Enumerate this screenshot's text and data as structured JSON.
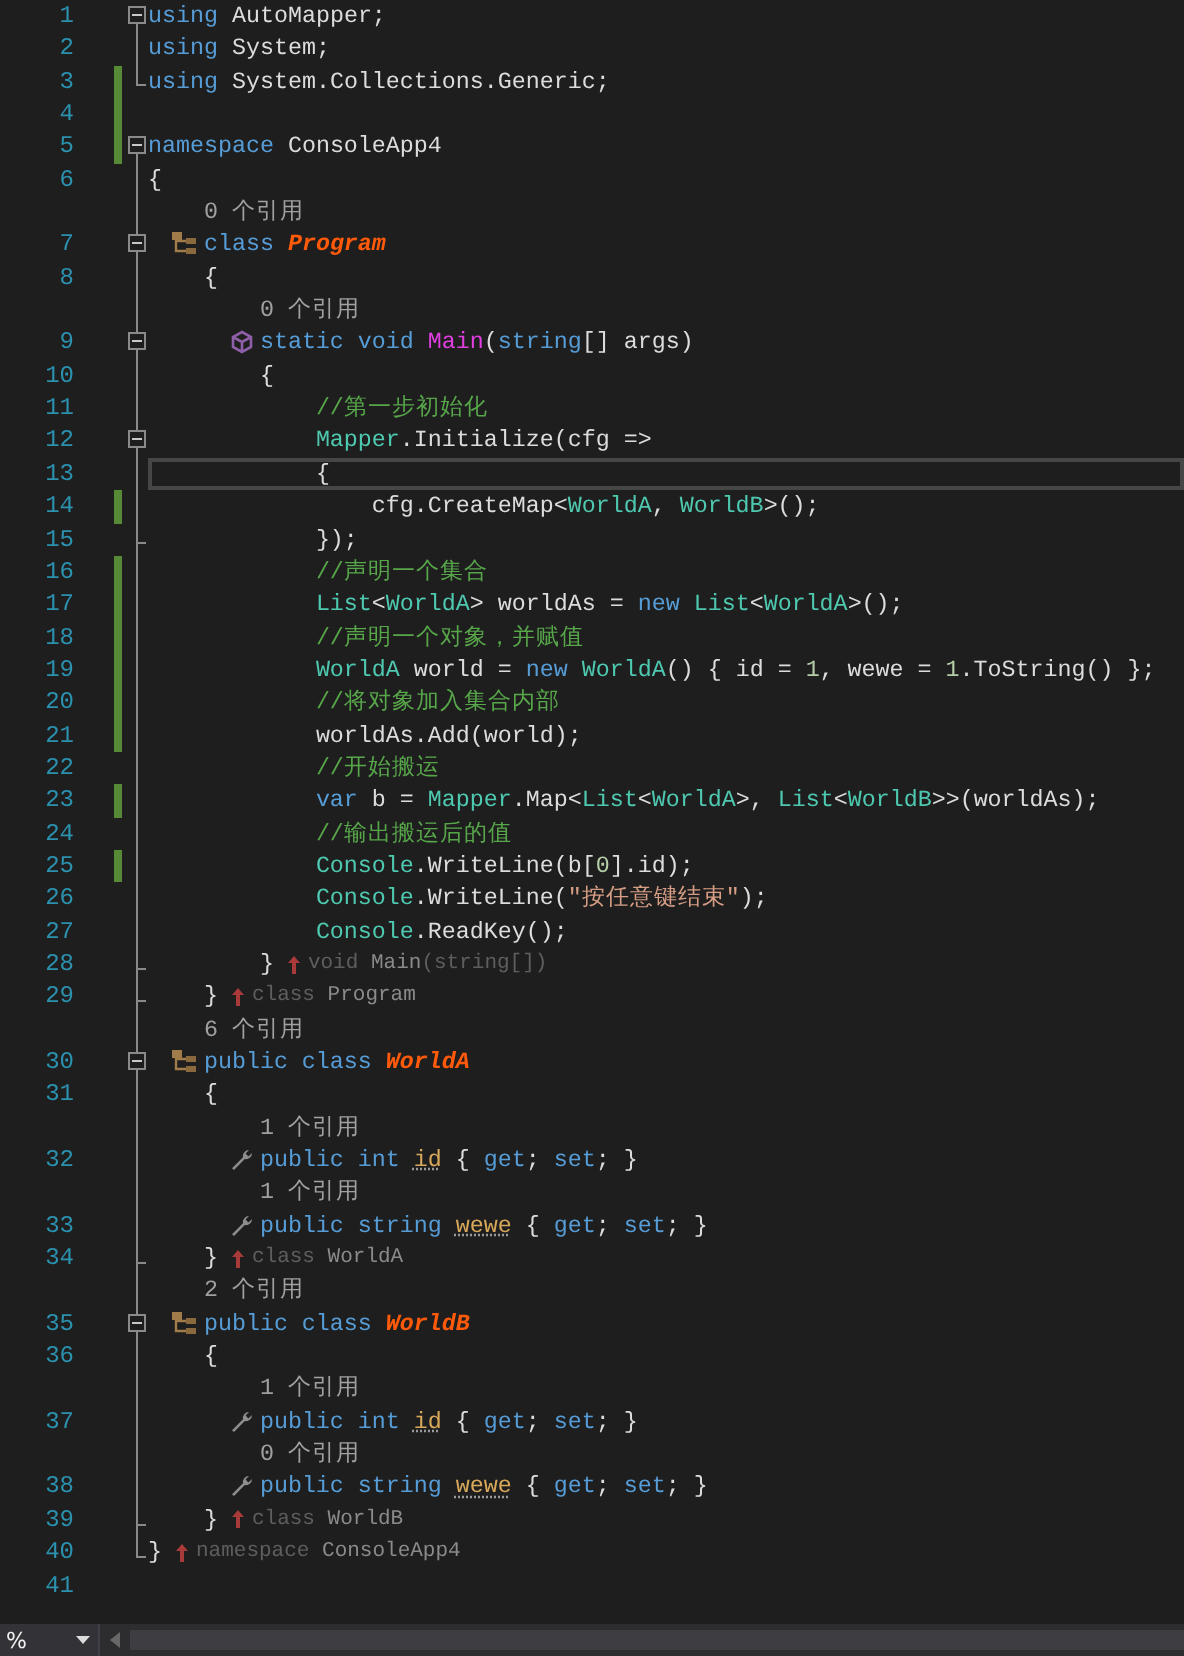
{
  "lines": [
    {
      "kind": "code",
      "number": "1",
      "changed": false,
      "current": false,
      "expanded": true,
      "tokens": [
        {
          "kind": "keyword",
          "text": "using "
        },
        {
          "kind": "plain",
          "text": "AutoMapper;"
        }
      ],
      "children": [
        {
          "kind": "code",
          "number": "2",
          "changed": false,
          "current": false,
          "tokens": [
            {
              "kind": "keyword",
              "text": "using "
            },
            {
              "kind": "plain",
              "text": "System;"
            }
          ]
        },
        {
          "kind": "code",
          "number": "3",
          "changed": true,
          "current": false,
          "tokens": [
            {
              "kind": "keyword",
              "text": "using "
            },
            {
              "kind": "plain",
              "text": "System.Collections.Generic;"
            }
          ]
        }
      ]
    },
    {
      "number": "4",
      "changed": true,
      "current": false
    },
    {
      "kind": "code",
      "number": "5",
      "changed": true,
      "current": false,
      "expanded": true,
      "tokens": [
        {
          "kind": "keyword",
          "text": "namespace "
        },
        {
          "kind": "plain",
          "text": "ConsoleApp4"
        }
      ],
      "children": [
        {
          "kind": "code",
          "number": "6",
          "changed": false,
          "current": false,
          "tokens": [
            {
              "kind": "plain",
              "text": "{"
            }
          ]
        },
        {
          "kind": "lens",
          "changed": false,
          "current": false,
          "tokens": [
            {
              "kind": "lens",
              "text": "    0 个引用"
            }
          ]
        },
        {
          "kind": "class",
          "number": "7",
          "changed": false,
          "current": false,
          "expanded": true,
          "tokens": [
            {
              "kind": "keyword",
              "text": "    class "
            },
            {
              "kind": "class-name",
              "text": "Program"
            }
          ],
          "children": [
            {
              "kind": "code",
              "number": "8",
              "changed": false,
              "current": false,
              "tokens": [
                {
                  "kind": "plain",
                  "text": "    {"
                }
              ]
            },
            {
              "kind": "lens",
              "changed": false,
              "current": false,
              "tokens": [
                {
                  "kind": "lens",
                  "text": "        0 个引用"
                }
              ]
            },
            {
              "kind": "method",
              "number": "9",
              "changed": false,
              "current": false,
              "expanded": true,
              "tokens": [
                {
                  "kind": "keyword",
                  "text": "        static void "
                },
                {
                  "kind": "method-name",
                  "text": "Main"
                },
                {
                  "kind": "plain",
                  "text": "("
                },
                {
                  "kind": "keyword",
                  "text": "string"
                },
                {
                  "kind": "plain",
                  "text": "[] args)"
                }
              ],
              "children": [
                {
                  "kind": "code",
                  "number": "10",
                  "changed": false,
                  "current": false,
                  "tokens": [
                    {
                      "kind": "plain",
                      "text": "        {"
                    }
                  ]
                },
                {
                  "kind": "code",
                  "number": "11",
                  "changed": false,
                  "current": false,
                  "tokens": [
                    {
                      "kind": "comment",
                      "text": "            //第一步初始化"
                    }
                  ]
                },
                {
                  "kind": "code",
                  "number": "12",
                  "changed": false,
                  "current": false,
                  "expanded": true,
                  "tokens": [
                    {
                      "kind": "type",
                      "text": "            Mapper"
                    },
                    {
                      "kind": "plain",
                      "text": ".Initialize(cfg =>"
                    }
                  ],
                  "children": [
                    {
                      "kind": "code",
                      "number": "13",
                      "changed": false,
                      "current": true,
                      "tokens": [
                        {
                          "kind": "plain",
                          "text": "            {"
                        }
                      ]
                    },
                    {
                      "kind": "code",
                      "number": "14",
                      "changed": true,
                      "current": false,
                      "tokens": [
                        {
                          "kind": "plain",
                          "text": "                cfg.CreateMap<"
                        },
                        {
                          "kind": "type",
                          "text": "WorldA"
                        },
                        {
                          "kind": "plain",
                          "text": ", "
                        },
                        {
                          "kind": "type",
                          "text": "WorldB"
                        },
                        {
                          "kind": "plain",
                          "text": ">();"
                        }
                      ]
                    },
                    {
                      "kind": "code",
                      "number": "15",
                      "changed": false,
                      "current": false,
                      "tokens": [
                        {
                          "kind": "plain",
                          "text": "            });"
                        }
                      ]
                    }
                  ]
                },
                {
                  "kind": "code",
                  "number": "16",
                  "changed": true,
                  "current": false,
                  "tokens": [
                    {
                      "kind": "comment",
                      "text": "            //声明一个集合"
                    }
                  ]
                },
                {
                  "kind": "code",
                  "number": "17",
                  "changed": true,
                  "current": false,
                  "tokens": [
                    {
                      "kind": "type",
                      "text": "            List"
                    },
                    {
                      "kind": "plain",
                      "text": "<"
                    },
                    {
                      "kind": "type",
                      "text": "WorldA"
                    },
                    {
                      "kind": "plain",
                      "text": "> worldAs = "
                    },
                    {
                      "kind": "keyword",
                      "text": "new "
                    },
                    {
                      "kind": "type",
                      "text": "List"
                    },
                    {
                      "kind": "plain",
                      "text": "<"
                    },
                    {
                      "kind": "type",
                      "text": "WorldA"
                    },
                    {
                      "kind": "plain",
                      "text": ">();"
                    }
                  ]
                },
                {
                  "kind": "code",
                  "number": "18",
                  "changed": true,
                  "current": false,
                  "tokens": [
                    {
                      "kind": "comment",
                      "text": "            //声明一个对象，并赋值"
                    }
                  ]
                },
                {
                  "kind": "code",
                  "number": "19",
                  "changed": true,
                  "current": false,
                  "tokens": [
                    {
                      "kind": "type",
                      "text": "            WorldA"
                    },
                    {
                      "kind": "plain",
                      "text": " world = "
                    },
                    {
                      "kind": "keyword",
                      "text": "new "
                    },
                    {
                      "kind": "type",
                      "text": "WorldA"
                    },
                    {
                      "kind": "plain",
                      "text": "() { id = "
                    },
                    {
                      "kind": "number",
                      "text": "1"
                    },
                    {
                      "kind": "plain",
                      "text": ", wewe = "
                    },
                    {
                      "kind": "number",
                      "text": "1"
                    },
                    {
                      "kind": "plain",
                      "text": ".ToString() };"
                    }
                  ]
                },
                {
                  "kind": "code",
                  "number": "20",
                  "changed": true,
                  "current": false,
                  "tokens": [
                    {
                      "kind": "comment",
                      "text": "            //将对象加入集合内部"
                    }
                  ]
                },
                {
                  "kind": "code",
                  "number": "21",
                  "changed": true,
                  "current": false,
                  "tokens": [
                    {
                      "kind": "plain",
                      "text": "            worldAs.Add(world);"
                    }
                  ]
                },
                {
                  "kind": "code",
                  "number": "22",
                  "changed": false,
                  "current": false,
                  "tokens": [
                    {
                      "kind": "comment",
                      "text": "            //开始搬运"
                    }
                  ]
                },
                {
                  "kind": "code",
                  "number": "23",
                  "changed": true,
                  "current": false,
                  "tokens": [
                    {
                      "kind": "keyword",
                      "text": "            var"
                    },
                    {
                      "kind": "plain",
                      "text": " b = "
                    },
                    {
                      "kind": "type",
                      "text": "Mapper"
                    },
                    {
                      "kind": "plain",
                      "text": ".Map<"
                    },
                    {
                      "kind": "type",
                      "text": "List"
                    },
                    {
                      "kind": "plain",
                      "text": "<"
                    },
                    {
                      "kind": "type",
                      "text": "WorldA"
                    },
                    {
                      "kind": "plain",
                      "text": ">, "
                    },
                    {
                      "kind": "type",
                      "text": "List"
                    },
                    {
                      "kind": "plain",
                      "text": "<"
                    },
                    {
                      "kind": "type",
                      "text": "WorldB"
                    },
                    {
                      "kind": "plain",
                      "text": ">>(worldAs);"
                    }
                  ]
                },
                {
                  "kind": "code",
                  "number": "24",
                  "changed": false,
                  "current": false,
                  "tokens": [
                    {
                      "kind": "comment",
                      "text": "            //输出搬运后的值"
                    }
                  ]
                },
                {
                  "kind": "code",
                  "number": "25",
                  "changed": true,
                  "current": false,
                  "tokens": [
                    {
                      "kind": "type",
                      "text": "            Console"
                    },
                    {
                      "kind": "plain",
                      "text": ".WriteLine(b["
                    },
                    {
                      "kind": "number",
                      "text": "0"
                    },
                    {
                      "kind": "plain",
                      "text": "].id);"
                    }
                  ]
                },
                {
                  "kind": "code",
                  "number": "26",
                  "changed": false,
                  "current": false,
                  "tokens": [
                    {
                      "kind": "type",
                      "text": "            Console"
                    },
                    {
                      "kind": "plain",
                      "text": ".WriteLine("
                    },
                    {
                      "kind": "string",
                      "text": "\"按任意键结束\""
                    },
                    {
                      "kind": "plain",
                      "text": ");"
                    }
                  ]
                },
                {
                  "kind": "code",
                  "number": "27",
                  "changed": false,
                  "current": false,
                  "tokens": [
                    {
                      "kind": "type",
                      "text": "            Console"
                    },
                    {
                      "kind": "plain",
                      "text": ".ReadKey();"
                    }
                  ]
                },
                {
                  "kind": "code",
                  "number": "28",
                  "changed": false,
                  "current": false,
                  "tokens": [
                    {
                      "kind": "plain",
                      "text": "        }"
                    }
                  ],
                  "hint": [
                    {
                      "kind": "hint-keyword",
                      "text": "void"
                    },
                    {
                      "kind": "hint-name",
                      "text": " Main"
                    },
                    {
                      "kind": "hint-keyword",
                      "text": "(string[])"
                    }
                  ]
                }
              ]
            },
            {
              "kind": "code",
              "number": "29",
              "changed": false,
              "current": false,
              "tokens": [
                {
                  "kind": "plain",
                  "text": "    }"
                }
              ],
              "hint": [
                {
                  "kind": "hint-keyword",
                  "text": "class"
                },
                {
                  "kind": "hint-name",
                  "text": " Program"
                }
              ]
            }
          ]
        },
        {
          "kind": "lens",
          "changed": false,
          "current": false,
          "tokens": [
            {
              "kind": "lens",
              "text": "    6 个引用"
            }
          ]
        },
        {
          "kind": "class",
          "number": "30",
          "changed": false,
          "current": false,
          "expanded": true,
          "tokens": [
            {
              "kind": "keyword",
              "text": "    public class "
            },
            {
              "kind": "class-name",
              "text": "WorldA"
            }
          ],
          "children": [
            {
              "kind": "code",
              "number": "31",
              "changed": false,
              "current": false,
              "tokens": [
                {
                  "kind": "plain",
                  "text": "    {"
                }
              ]
            },
            {
              "kind": "lens",
              "changed": false,
              "current": false,
              "tokens": [
                {
                  "kind": "lens",
                  "text": "        1 个引用"
                }
              ]
            },
            {
              "kind": "property",
              "number": "32",
              "changed": false,
              "current": false,
              "tokens": [
                {
                  "kind": "keyword",
                  "text": "        public int "
                },
                {
                  "kind": "property",
                  "text": "id"
                },
                {
                  "kind": "plain",
                  "text": " { "
                },
                {
                  "kind": "keyword",
                  "text": "get"
                },
                {
                  "kind": "plain",
                  "text": "; "
                },
                {
                  "kind": "keyword",
                  "text": "set"
                },
                {
                  "kind": "plain",
                  "text": "; }"
                }
              ]
            },
            {
              "kind": "lens",
              "changed": false,
              "current": false,
              "tokens": [
                {
                  "kind": "lens",
                  "text": "        1 个引用"
                }
              ]
            },
            {
              "kind": "property",
              "number": "33",
              "changed": false,
              "current": false,
              "tokens": [
                {
                  "kind": "keyword",
                  "text": "        public string "
                },
                {
                  "kind": "property",
                  "text": "wewe"
                },
                {
                  "kind": "plain",
                  "text": " { "
                },
                {
                  "kind": "keyword",
                  "text": "get"
                },
                {
                  "kind": "plain",
                  "text": "; "
                },
                {
                  "kind": "keyword",
                  "text": "set"
                },
                {
                  "kind": "plain",
                  "text": "; }"
                }
              ]
            },
            {
              "kind": "code",
              "number": "34",
              "changed": false,
              "current": false,
              "tokens": [
                {
                  "kind": "plain",
                  "text": "    }"
                }
              ],
              "hint": [
                {
                  "kind": "hint-keyword",
                  "text": "class"
                },
                {
                  "kind": "hint-name",
                  "text": " WorldA"
                }
              ]
            }
          ]
        },
        {
          "kind": "lens",
          "changed": false,
          "current": false,
          "tokens": [
            {
              "kind": "lens",
              "text": "    2 个引用"
            }
          ]
        },
        {
          "kind": "class",
          "number": "35",
          "changed": false,
          "current": false,
          "expanded": true,
          "tokens": [
            {
              "kind": "keyword",
              "text": "    public class "
            },
            {
              "kind": "class-name",
              "text": "WorldB"
            }
          ],
          "children": [
            {
              "kind": "code",
              "number": "36",
              "changed": false,
              "current": false,
              "tokens": [
                {
                  "kind": "plain",
                  "text": "    {"
                }
              ]
            },
            {
              "kind": "lens",
              "changed": false,
              "current": false,
              "tokens": [
                {
                  "kind": "lens",
                  "text": "        1 个引用"
                }
              ]
            },
            {
              "kind": "property",
              "number": "37",
              "changed": false,
              "current": false,
              "tokens": [
                {
                  "kind": "keyword",
                  "text": "        public int "
                },
                {
                  "kind": "property",
                  "text": "id"
                },
                {
                  "kind": "plain",
                  "text": " { "
                },
                {
                  "kind": "keyword",
                  "text": "get"
                },
                {
                  "kind": "plain",
                  "text": "; "
                },
                {
                  "kind": "keyword",
                  "text": "set"
                },
                {
                  "kind": "plain",
                  "text": "; }"
                }
              ]
            },
            {
              "kind": "lens",
              "changed": false,
              "current": false,
              "tokens": [
                {
                  "kind": "lens",
                  "text": "        0 个引用"
                }
              ]
            },
            {
              "kind": "property",
              "number": "38",
              "changed": false,
              "current": false,
              "tokens": [
                {
                  "kind": "keyword",
                  "text": "        public string "
                },
                {
                  "kind": "property",
                  "text": "wewe"
                },
                {
                  "kind": "plain",
                  "text": " { "
                },
                {
                  "kind": "keyword",
                  "text": "get"
                },
                {
                  "kind": "plain",
                  "text": "; "
                },
                {
                  "kind": "keyword",
                  "text": "set"
                },
                {
                  "kind": "plain",
                  "text": "; }"
                }
              ]
            },
            {
              "kind": "code",
              "number": "39",
              "changed": false,
              "current": false,
              "tokens": [
                {
                  "kind": "plain",
                  "text": "    }"
                }
              ],
              "hint": [
                {
                  "kind": "hint-keyword",
                  "text": "class"
                },
                {
                  "kind": "hint-name",
                  "text": " WorldB"
                }
              ]
            }
          ]
        },
        {
          "kind": "code",
          "number": "40",
          "changed": false,
          "current": false,
          "tokens": [
            {
              "kind": "plain",
              "text": "}"
            }
          ],
          "hint": [
            {
              "kind": "hint-keyword",
              "text": "namespace"
            },
            {
              "kind": "hint-name",
              "text": " ConsoleApp4"
            }
          ]
        }
      ]
    },
    {
      "number": "41",
      "changed": false,
      "current": false
    }
  ],
  "status_bar": {
    "zoom": "%"
  }
}
